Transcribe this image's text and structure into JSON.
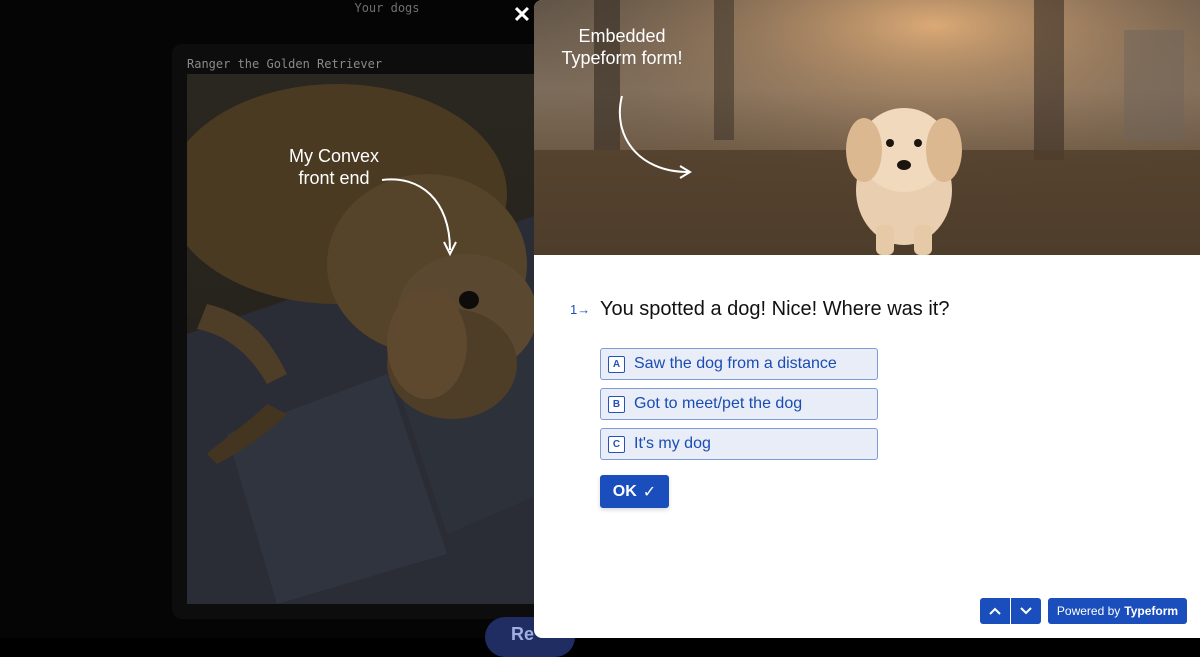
{
  "background_app": {
    "title": "Your dogs",
    "dog_caption": "Ranger the Golden Retriever",
    "button_label": "Re"
  },
  "annotations": {
    "front_end": "My Convex front end",
    "embedded": "Embedded Typeform form!"
  },
  "modal": {
    "close_label": "✕"
  },
  "form": {
    "question_number": "1→",
    "question": "You spotted a dog! Nice! Where was it?",
    "choices": [
      {
        "key": "A",
        "label": "Saw the dog from a distance"
      },
      {
        "key": "B",
        "label": "Got to meet/pet the dog"
      },
      {
        "key": "C",
        "label": "It's my dog"
      }
    ],
    "ok_label": "OK",
    "ok_icon": "✓",
    "nav_up": "chevron-up-icon",
    "nav_down": "chevron-down-icon",
    "powered_prefix": "Powered by",
    "powered_brand": "Typeform"
  },
  "colors": {
    "accent": "#1a4ebc",
    "choice_bg": "#e8edf8",
    "backdrop": "#000000"
  }
}
